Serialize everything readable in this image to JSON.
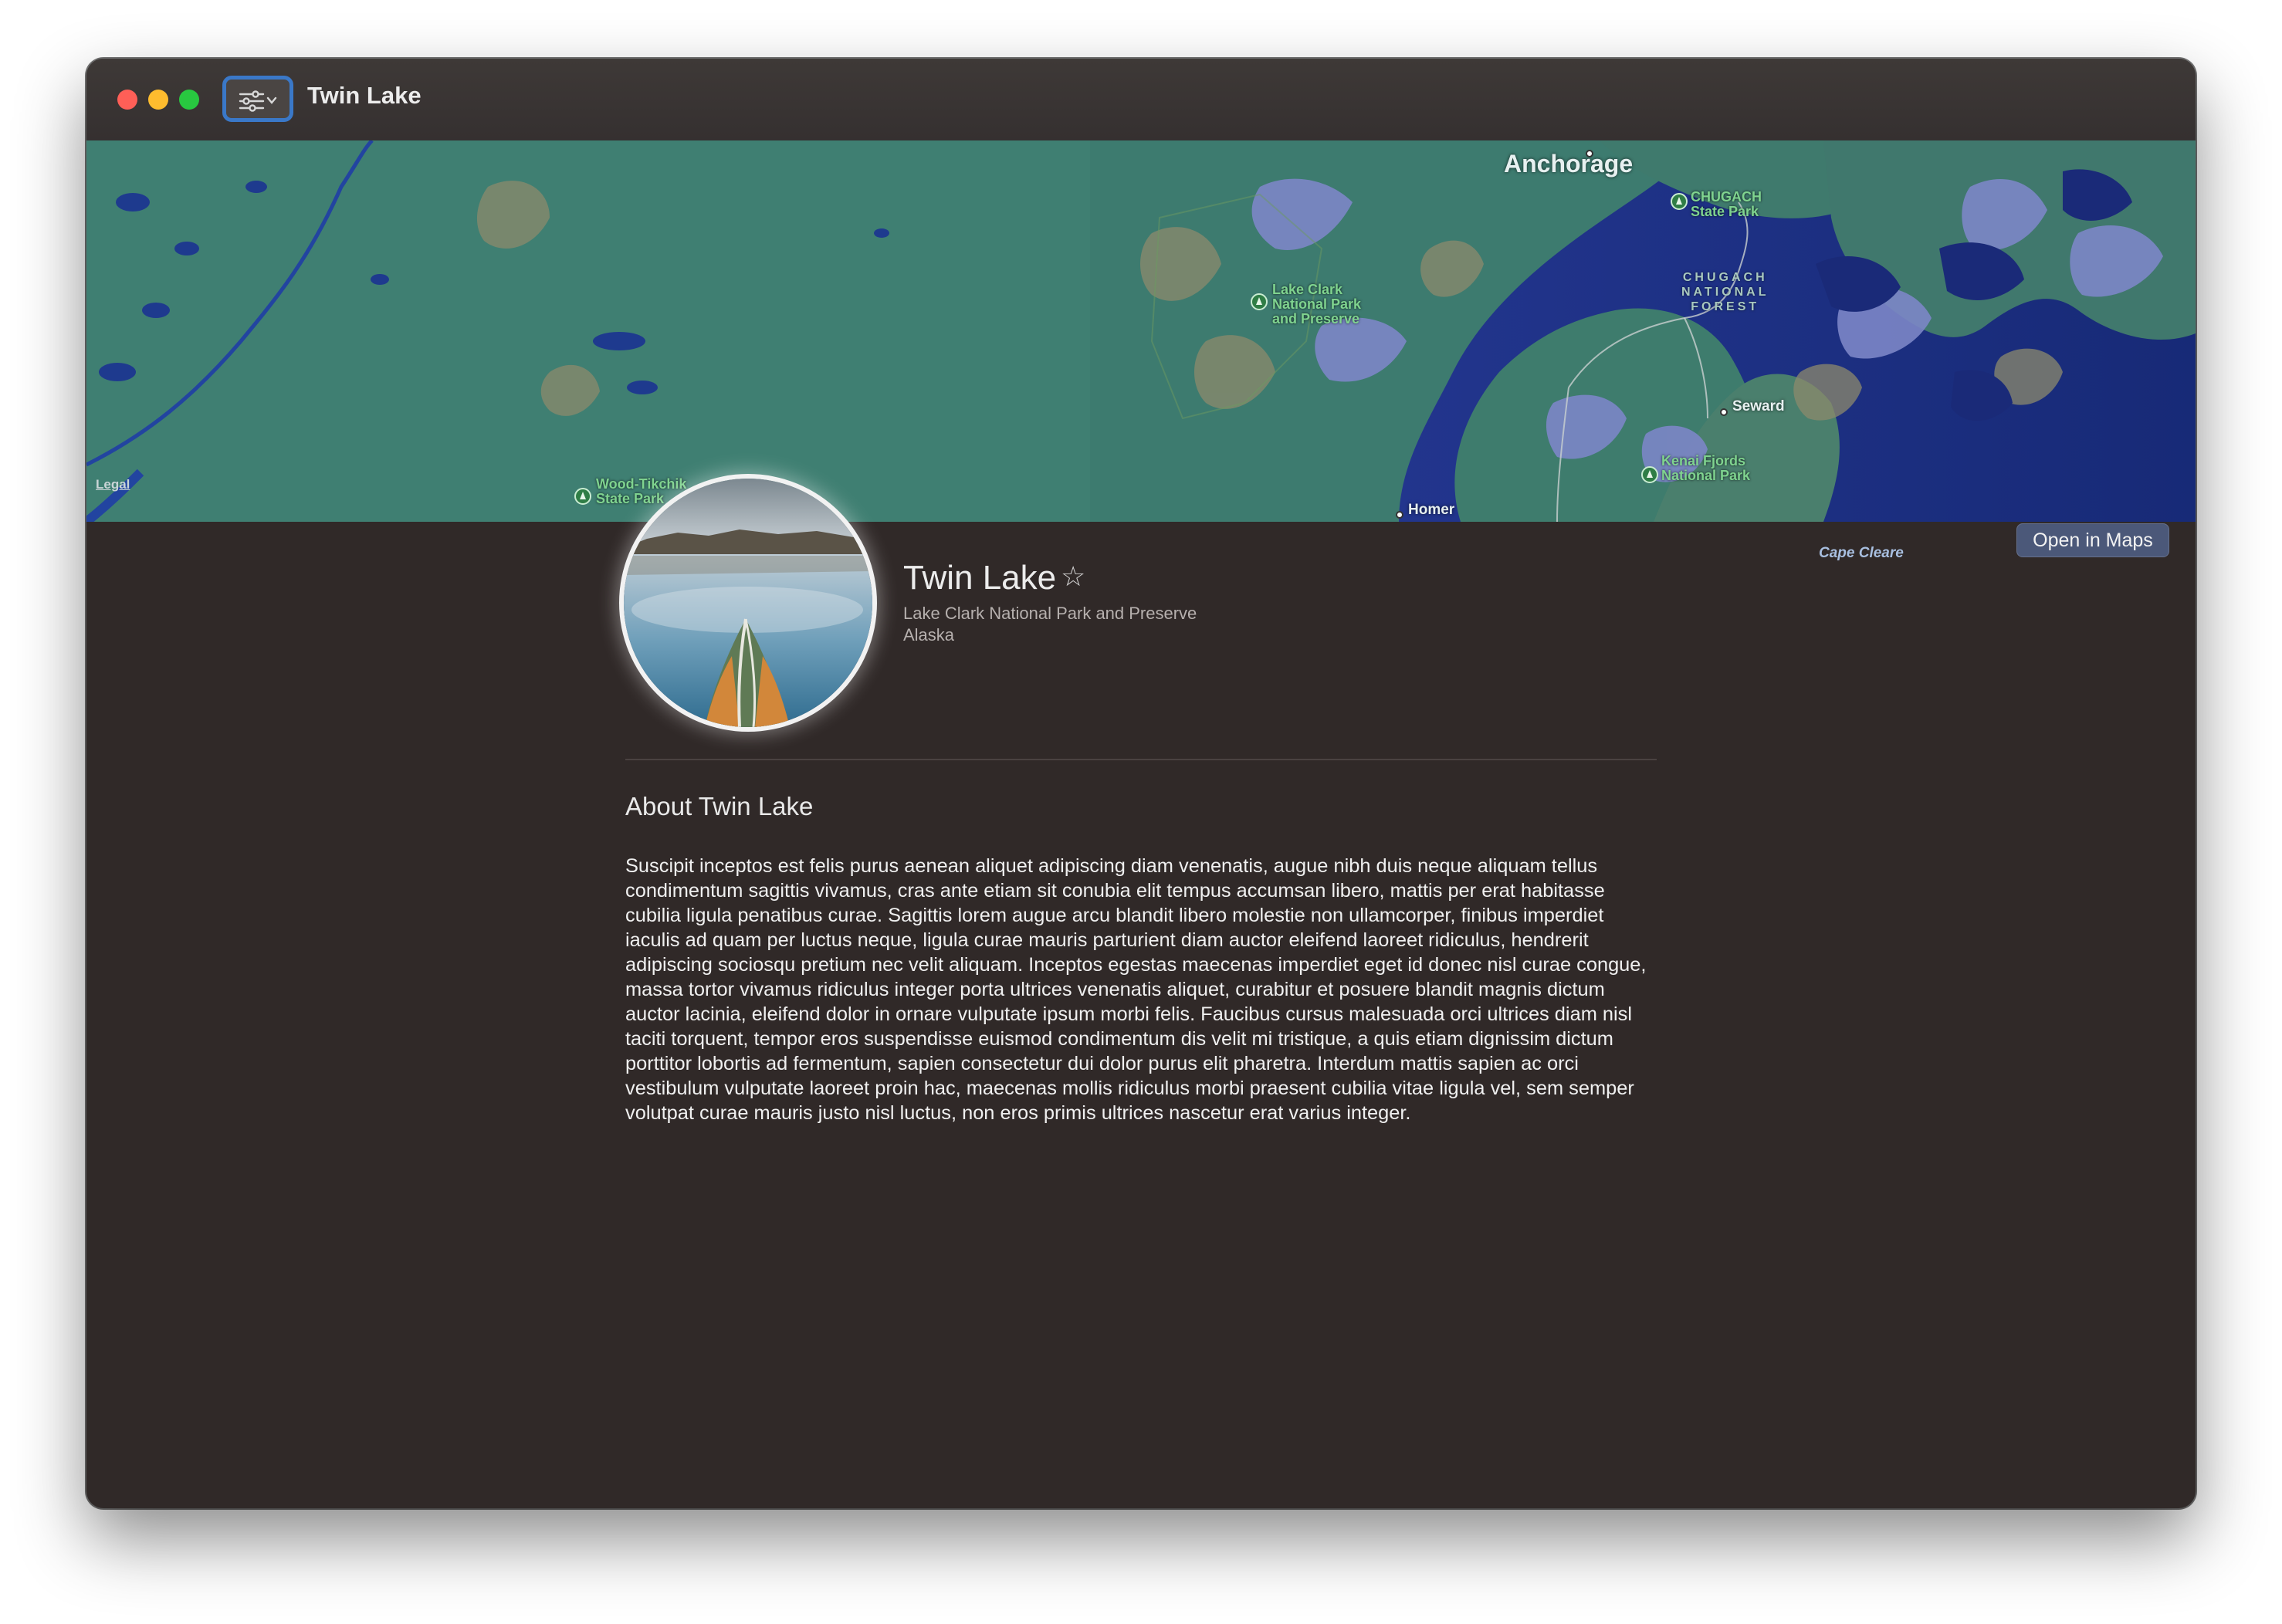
{
  "window": {
    "title": "Twin Lake",
    "controls": [
      "close",
      "minimize",
      "zoom"
    ],
    "sidebar_button_icon": "sidebar-toggle-icon"
  },
  "map": {
    "labels": {
      "anchorage": "Anchorage",
      "chugach_state_park": "CHUGACH\nState Park",
      "chugach_forest": "CHUGACH\nNATIONAL\nFOREST",
      "lake_clark": "Lake Clark\nNational Park\nand Preserve",
      "seward": "Seward",
      "kenai": "Kenai Fjords\nNational Park",
      "wood_tikchik": "Wood-Tikchik\nState Park",
      "homer": "Homer",
      "cape_cleare": "Cape Cleare"
    },
    "legal_label": "Legal",
    "open_button_label": "Open in Maps"
  },
  "place": {
    "name": "Twin Lake",
    "favorite_icon": "star-outline-icon",
    "park": "Lake Clark National Park and Preserve",
    "state": "Alaska"
  },
  "about": {
    "heading": "About Twin Lake",
    "body": "Suscipit inceptos est felis purus aenean aliquet adipiscing diam venenatis, augue nibh duis neque aliquam tellus condimentum sagittis vivamus, cras ante etiam sit conubia elit tempus accumsan libero, mattis per erat habitasse cubilia ligula penatibus curae. Sagittis lorem augue arcu blandit libero molestie non ullamcorper, finibus imperdiet iaculis ad quam per luctus neque, ligula curae mauris parturient diam auctor eleifend laoreet ridiculus, hendrerit adipiscing sociosqu pretium nec velit aliquam. Inceptos egestas maecenas imperdiet eget id donec nisl curae congue, massa tortor vivamus ridiculus integer porta ultrices venenatis aliquet, curabitur et posuere blandit magnis dictum auctor lacinia, eleifend dolor in ornare vulputate ipsum morbi felis. Faucibus cursus malesuada orci ultrices diam nisl taciti torquent, tempor eros suspendisse euismod condimentum dis velit mi tristique, a quis etiam dignissim dictum porttitor lobortis ad fermentum, sapien consectetur dui dolor purus elit pharetra. Interdum mattis sapien ac orci vestibulum vulputate laoreet proin hac, maecenas mollis ridiculus morbi praesent cubilia vitae ligula vel, sem semper volutpat curae mauris justo nisl luctus, non eros primis ultrices nascetur erat varius integer."
  },
  "colors": {
    "window_bg": "#302928",
    "land": "#3b7a6e",
    "water_deep": "#1b2f82",
    "highland": "#8d8a6a",
    "glacier": "#7b86c6",
    "button": "#4b5879"
  }
}
